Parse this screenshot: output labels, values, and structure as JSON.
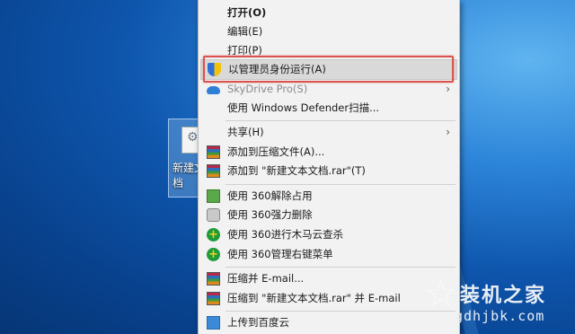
{
  "desktop": {
    "file_label": "新建文本文档"
  },
  "context_menu": {
    "items": [
      {
        "label": "打开(O)"
      },
      {
        "label": "编辑(E)"
      },
      {
        "label": "打印(P)"
      },
      {
        "label": "以管理员身份运行(A)",
        "icon": "uac-shield-icon"
      },
      {
        "label": "SkyDrive Pro(S)",
        "icon": "cloud-icon"
      },
      {
        "label": "使用 Windows Defender扫描..."
      },
      {
        "label": "共享(H)"
      },
      {
        "label": "添加到压缩文件(A)...",
        "icon": "winrar-icon"
      },
      {
        "label": "添加到 \"新建文本文档.rar\"(T)",
        "icon": "winrar-icon"
      },
      {
        "label": "使用 360解除占用",
        "icon": "360-unlock-icon"
      },
      {
        "label": "使用 360强力删除",
        "icon": "360-shred-icon"
      },
      {
        "label": "使用 360进行木马云查杀",
        "icon": "360-scan-icon"
      },
      {
        "label": "使用 360管理右键菜单",
        "icon": "360-scan-icon"
      },
      {
        "label": "压缩并 E-mail...",
        "icon": "winrar-icon"
      },
      {
        "label": "压缩到 \"新建文本文档.rar\" 并 E-mail",
        "icon": "winrar-icon"
      },
      {
        "label": "上传到百度云",
        "icon": "baidu-cloud-icon"
      }
    ]
  },
  "watermark": {
    "title": "装机之家",
    "url": "gdhjbk.com"
  },
  "colors": {
    "highlight_border": "#d9534f",
    "menu_background": "#f2f2f2"
  }
}
